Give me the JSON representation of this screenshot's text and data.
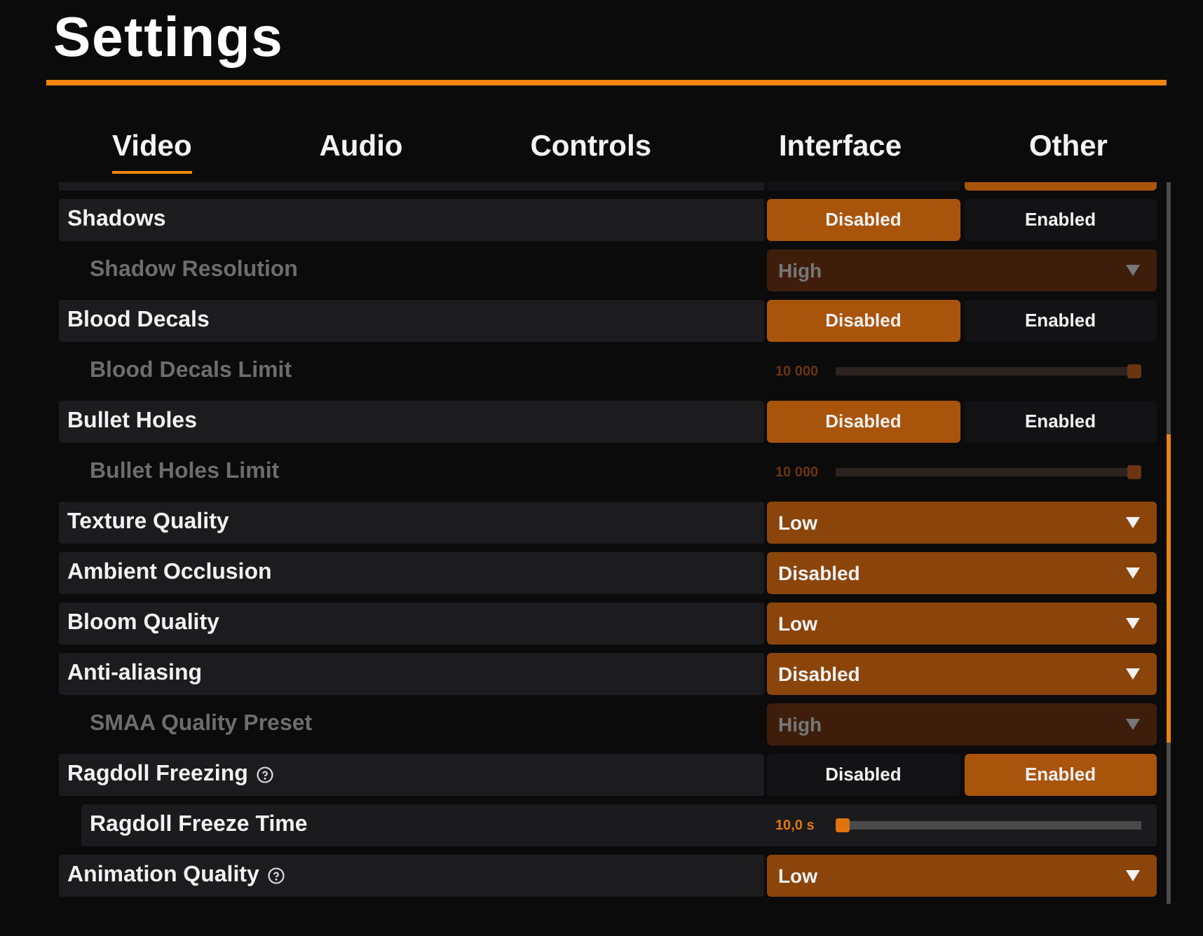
{
  "window": {
    "title": "Settings"
  },
  "tabs": [
    {
      "label": "Video",
      "selected": true
    },
    {
      "label": "Audio",
      "selected": false
    },
    {
      "label": "Controls",
      "selected": false
    },
    {
      "label": "Interface",
      "selected": false
    },
    {
      "label": "Other",
      "selected": false
    }
  ],
  "settings": {
    "clipped_row": {
      "kind": "toggle",
      "options": [
        {
          "selected": false
        },
        {
          "selected": true
        }
      ]
    },
    "rows": [
      {
        "kind": "toggle",
        "label": "Shadows",
        "help": false,
        "disabled": false,
        "options": [
          {
            "label": "Disabled",
            "selected": true
          },
          {
            "label": "Enabled",
            "selected": false
          }
        ],
        "children": [
          {
            "kind": "dropdown",
            "label": "Shadow Resolution",
            "help": false,
            "disabled": true,
            "value": "High"
          }
        ]
      },
      {
        "kind": "toggle",
        "label": "Blood Decals",
        "help": false,
        "disabled": false,
        "options": [
          {
            "label": "Disabled",
            "selected": true
          },
          {
            "label": "Enabled",
            "selected": false
          }
        ],
        "children": [
          {
            "kind": "slider",
            "label": "Blood Decals Limit",
            "help": false,
            "disabled": true,
            "reading": "10 000",
            "level": 1
          }
        ]
      },
      {
        "kind": "toggle",
        "label": "Bullet Holes",
        "help": false,
        "disabled": false,
        "options": [
          {
            "label": "Disabled",
            "selected": true
          },
          {
            "label": "Enabled",
            "selected": false
          }
        ],
        "children": [
          {
            "kind": "slider",
            "label": "Bullet Holes Limit",
            "help": false,
            "disabled": true,
            "reading": "10 000",
            "level": 1
          }
        ]
      },
      {
        "kind": "dropdown",
        "label": "Texture Quality",
        "help": false,
        "disabled": false,
        "value": "Low"
      },
      {
        "kind": "dropdown",
        "label": "Ambient Occlusion",
        "help": false,
        "disabled": false,
        "value": "Disabled"
      },
      {
        "kind": "dropdown",
        "label": "Bloom Quality",
        "help": false,
        "disabled": false,
        "value": "Low"
      },
      {
        "kind": "dropdown",
        "label": "Anti-aliasing",
        "help": false,
        "disabled": false,
        "value": "Disabled",
        "children": [
          {
            "kind": "dropdown",
            "label": "SMAA Quality Preset",
            "help": false,
            "disabled": true,
            "value": "High"
          }
        ]
      },
      {
        "kind": "toggle",
        "label": "Ragdoll Freezing",
        "help": true,
        "disabled": false,
        "options": [
          {
            "label": "Disabled",
            "selected": false
          },
          {
            "label": "Enabled",
            "selected": true
          }
        ],
        "children": [
          {
            "kind": "slider",
            "label": "Ragdoll Freeze Time",
            "help": false,
            "disabled": false,
            "reading": "10,0 s",
            "level": 0
          }
        ]
      },
      {
        "kind": "dropdown",
        "label": "Animation Quality",
        "help": true,
        "disabled": false,
        "value": "Low"
      }
    ]
  }
}
